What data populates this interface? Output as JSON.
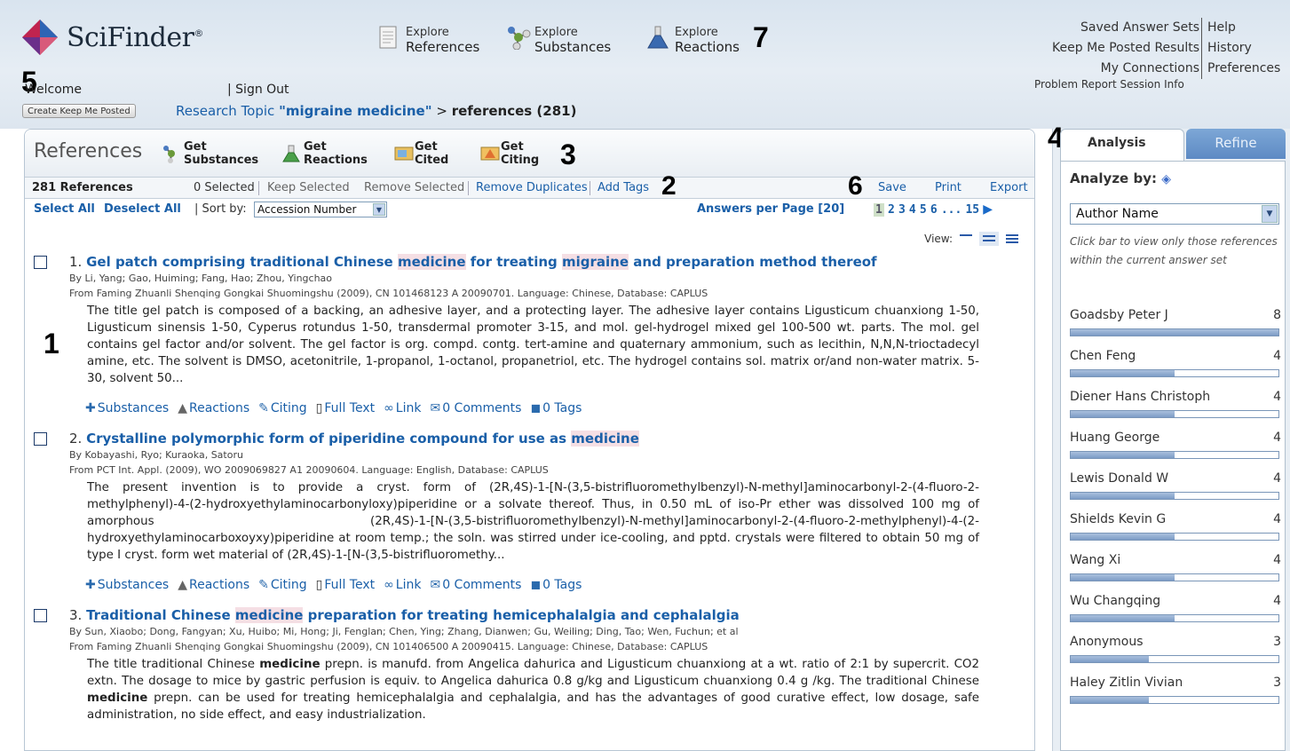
{
  "header": {
    "brand": "SciFinder",
    "brand_mark": "®",
    "explore": [
      {
        "l1": "Explore",
        "l2": "References",
        "icon": "document-icon"
      },
      {
        "l1": "Explore",
        "l2": "Substances",
        "icon": "molecule-icon"
      },
      {
        "l1": "Explore",
        "l2": "Reactions",
        "icon": "flask-icon"
      }
    ],
    "welcome": "Welcome",
    "sign_out": "| Sign Out",
    "keep_me_posted_button": "Create Keep Me Posted",
    "breadcrumb_topic_label": "Research Topic",
    "breadcrumb_topic_query": "\"migraine medicine\"",
    "breadcrumb_sep": ">",
    "breadcrumb_current": "references (281)",
    "top_links_left": [
      "Saved Answer Sets",
      "Keep Me Posted Results",
      "My Connections"
    ],
    "top_links_right": [
      "Help",
      "History",
      "Preferences"
    ],
    "problem_report": "Problem Report Session Info"
  },
  "callouts": [
    "1",
    "2",
    "3",
    "4",
    "5",
    "6",
    "7"
  ],
  "toolbar": {
    "title": "References",
    "get_buttons": [
      {
        "l1": "Get",
        "l2": "Substances",
        "icon": "molecule-icon"
      },
      {
        "l1": "Get",
        "l2": "Reactions",
        "icon": "flask-icon"
      },
      {
        "l1": "Get",
        "l2": "Cited",
        "icon": "cited-icon"
      },
      {
        "l1": "Get",
        "l2": "Citing",
        "icon": "citing-icon"
      }
    ]
  },
  "actionbar": {
    "count": "281 References",
    "selected": "0 Selected",
    "keep_selected": "Keep Selected",
    "remove_selected": "Remove Selected",
    "remove_duplicates": "Remove Duplicates",
    "add_tags": "Add Tags",
    "save": "Save",
    "print": "Print",
    "export": "Export"
  },
  "selbar": {
    "select_all": "Select All",
    "deselect_all": "Deselect All",
    "sort_label": "| Sort by:",
    "sort_value": "Accession Number",
    "answers_per_page": "Answers per Page [20]",
    "pages": [
      "1",
      "2",
      "3",
      "4",
      "5",
      "6",
      "...",
      "15"
    ],
    "current_page": "1"
  },
  "view_label": "View:",
  "results": [
    {
      "num": "1.",
      "title_parts": [
        "Gel patch comprising traditional Chinese ",
        "medicine",
        " for treating ",
        "migraine",
        " and preparation method thereof"
      ],
      "by": "By Li, Yang; Gao, Huiming; Fang, Hao; Zhou, Yingchao",
      "from": "From Faming Zhuanli Shenqing Gongkai Shuomingshu (2009), CN 101468123 A 20090701. Language: Chinese, Database: CAPLUS",
      "abstract": "The title gel patch is composed of a backing, an adhesive layer, and a protecting layer.  The adhesive layer contains Ligusticum chuanxiong 1-50, Ligusticum sinensis 1-50, Cyperus rotundus 1-50, transdermal promoter 3-15, and mol. gel-hydrogel mixed gel 100-500 wt. parts.  The mol. gel contains gel factor and/or solvent.  The gel factor is org. compd. contg. tert-amine and quaternary ammonium, such as lecithin, N,N,N-trioctadecyl amine, etc.  The solvent is DMSO, acetonitrile, 1-propanol, 1-octanol, propanetriol, etc.  The hydrogel contains sol. matrix or/and non-water matrix. 5-30, solvent 50...",
      "links": [
        "Substances",
        "Reactions",
        "Citing",
        "Full Text",
        "Link",
        "0 Comments",
        "0 Tags"
      ]
    },
    {
      "num": "2.",
      "title_parts": [
        "Crystalline polymorphic form of piperidine compound for use as ",
        "medicine",
        "",
        "",
        ""
      ],
      "by": "By Kobayashi, Ryo; Kuraoka, Satoru",
      "from": "From PCT Int. Appl. (2009), WO 2009069827 A1 20090604. Language: English, Database: CAPLUS",
      "abstract": "The present invention is to provide a cryst. form of (2R,4S)-1-[N-(3,5-bistrifluoromethylbenzyl)-N-methyl]aminocarbonyl-2-(4-fluoro-2-methylphenyl)-4-(2-hydroxyethylaminocarbonyloxy)piperidine or a solvate thereof.  Thus, in 0.50 mL of iso-Pr ether was dissolved 100 mg of amorphous (2R,4S)-1-[N-(3,5-bistrifluoromethylbenzyl)-N-methyl]aminocarbonyl-2-(4-fluoro-2-methylphenyl)-4-(2-hydroxyethylaminocarboxoyxy)piperidine at room temp.; the soln. was stirred under ice-cooling, and pptd. crystals were filtered to obtain 50 mg of type I cryst. form wet material of (2R,4S)-1-[N-(3,5-bistrifluoromethy...",
      "links": [
        "Substances",
        "Reactions",
        "Citing",
        "Full Text",
        "Link",
        "0 Comments",
        "0 Tags"
      ]
    },
    {
      "num": "3.",
      "title_parts": [
        "Traditional Chinese ",
        "medicine",
        " preparation for treating hemicephalalgia and cephalalgia",
        "",
        ""
      ],
      "by": "By Sun, Xiaobo; Dong, Fangyan; Xu, Huibo; Mi, Hong; Ji, Fenglan; Chen, Ying; Zhang, Dianwen; Gu, Weiling; Ding, Tao; Wen, Fuchun; et al",
      "from": "From Faming Zhuanli Shenqing Gongkai Shuomingshu (2009), CN 101406500 A 20090415. Language: Chinese, Database: CAPLUS",
      "abstract_parts": [
        "The title traditional Chinese ",
        "medicine",
        " prepn. is manufd. from Angelica dahurica and Ligusticum chuanxiong at a wt. ratio of 2:1 by supercrit. CO2 extn.  The dosage to mice by gastric perfusion is equiv. to Angelica dahurica 0.8 g/kg and Ligusticum chuanxiong 0.4 g /kg.  The traditional Chinese ",
        "medicine",
        " prepn. can be used for treating hemicephalalgia and cephalalgia, and has the advantages of good curative effect, low dosage, safe administration, no side effect, and easy industrialization."
      ]
    }
  ],
  "analysis": {
    "tab_analysis": "Analysis",
    "tab_refine": "Refine",
    "analyze_by": "Analyze by:",
    "analyze_value": "Author Name",
    "hint": "Click bar to view only those references within the current answer set",
    "max_count": 8,
    "authors": [
      {
        "name": "Goadsby Peter J",
        "count": 8
      },
      {
        "name": "Chen Feng",
        "count": 4
      },
      {
        "name": "Diener Hans Christoph",
        "count": 4
      },
      {
        "name": "Huang George",
        "count": 4
      },
      {
        "name": "Lewis Donald W",
        "count": 4
      },
      {
        "name": "Shields Kevin G",
        "count": 4
      },
      {
        "name": "Wang Xi",
        "count": 4
      },
      {
        "name": "Wu Changqing",
        "count": 4
      },
      {
        "name": "Anonymous",
        "count": 3
      },
      {
        "name": "Haley Zitlin Vivian",
        "count": 3
      }
    ]
  },
  "colors": {
    "link": "#1a5fa8",
    "highlight": "#f5dfe4",
    "refine_tab": "#6d97cc"
  }
}
